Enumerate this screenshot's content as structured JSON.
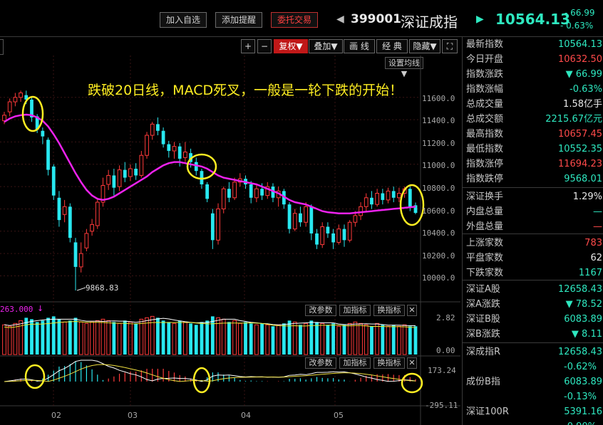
{
  "topbar": {
    "buttons": [
      "加入自选",
      "添加提醒",
      "委托交易"
    ],
    "prev_arrow": "◀",
    "next_arrow": "▶",
    "code": "399001",
    "name": "深证成指",
    "price": "10564.13",
    "change": "- 66.99",
    "change_pct": "- 0.63%"
  },
  "toolbar": {
    "plus": "+",
    "minus": "−",
    "restore": "复权",
    "overlay": "叠加",
    "draw_line": "画 线",
    "classic": "经 典",
    "hide": "隐藏",
    "avg_settings": "设置均线"
  },
  "annotation": "跌破20日线，MACD死叉，一般是一轮下跌的开始！",
  "price_axis": [
    "11600.0",
    "11400.0",
    "11200.0",
    "11000.0",
    "10800.0",
    "10600.0",
    "10400.0",
    "10200.0",
    "10000.0"
  ],
  "low_label": "9868.83",
  "volume_panel": {
    "label": "263.000",
    "param_btn": "改参数",
    "add_btn": "加指标",
    "switch_btn": "换指标",
    "axis": [
      "2.82",
      "0.00"
    ]
  },
  "macd_panel": {
    "param_btn": "改参数",
    "add_btn": "加指标",
    "switch_btn": "换指标",
    "axis": [
      "173.24",
      "-295.11"
    ]
  },
  "dates": [
    "02",
    "03",
    "04",
    "05"
  ],
  "colors": {
    "up": "#ff3a3a",
    "down": "#28e8f0",
    "ma20": "#ee22ee",
    "highlight": "#ffee22"
  },
  "info": [
    {
      "label": "最新指数",
      "value": "10564.13",
      "color": "#2ee8c0"
    },
    {
      "label": "今日开盘",
      "value": "10632.50",
      "color": "#ff4a4a"
    },
    {
      "label": "指数涨跌",
      "value": "▼ 66.99",
      "color": "#2ee8c0"
    },
    {
      "label": "指数涨幅",
      "value": "-0.63%",
      "color": "#2ee8c0"
    },
    {
      "label": "总成交量",
      "value": "1.58亿手",
      "color": "#e8e8e8"
    },
    {
      "label": "总成交额",
      "value": "2215.67亿元",
      "color": "#2ee8c0"
    },
    {
      "label": "最高指数",
      "value": "10657.45",
      "color": "#ff4a4a"
    },
    {
      "label": "最低指数",
      "value": "10552.35",
      "color": "#2ee8c0"
    },
    {
      "label": "指数涨停",
      "value": "11694.23",
      "color": "#ff4a4a"
    },
    {
      "label": "指数跌停",
      "value": "9568.01",
      "color": "#2ee8c0"
    },
    {
      "label": "深证换手",
      "value": "1.29%",
      "color": "#e8e8e8"
    },
    {
      "label": "内盘总量",
      "value": "—",
      "color": "#2ee8c0"
    },
    {
      "label": "外盘总量",
      "value": "—",
      "color": "#ff4a4a"
    },
    {
      "label": "上涨家数",
      "value": "783",
      "color": "#ff4a4a"
    },
    {
      "label": "平盘家数",
      "value": "62",
      "color": "#e8e8e8"
    },
    {
      "label": "下跌家数",
      "value": "1167",
      "color": "#2ee8c0"
    },
    {
      "label": "深证A股",
      "value": "12658.43",
      "color": "#2ee8c0"
    },
    {
      "label": "深A涨跌",
      "value": "▼ 78.52",
      "color": "#2ee8c0"
    },
    {
      "label": "深证B股",
      "value": "6083.89",
      "color": "#2ee8c0"
    },
    {
      "label": "深B涨跌",
      "value": "▼ 8.11",
      "color": "#2ee8c0"
    },
    {
      "label": "深成指R",
      "value": "12658.43",
      "color": "#2ee8c0"
    },
    {
      "label": "",
      "value": "-0.62%",
      "color": "#2ee8c0"
    },
    {
      "label": "成份B指",
      "value": "6083.89",
      "color": "#2ee8c0"
    },
    {
      "label": "",
      "value": "-0.13%",
      "color": "#2ee8c0"
    },
    {
      "label": "深证100R",
      "value": "5391.16",
      "color": "#2ee8c0"
    },
    {
      "label": "",
      "value": "-0.90%",
      "color": "#2ee8c0"
    }
  ],
  "chart_data": {
    "type": "candlestick",
    "series": [
      {
        "o": 11390,
        "c": 11440,
        "h": 11470,
        "l": 11360
      },
      {
        "o": 11470,
        "c": 11560,
        "h": 11590,
        "l": 11430
      },
      {
        "o": 11560,
        "c": 11600,
        "h": 11640,
        "l": 11520
      },
      {
        "o": 11600,
        "c": 11640,
        "h": 11660,
        "l": 11560
      },
      {
        "o": 11620,
        "c": 11580,
        "h": 11660,
        "l": 11540
      },
      {
        "o": 11580,
        "c": 11420,
        "h": 11600,
        "l": 11380
      },
      {
        "o": 11430,
        "c": 11310,
        "h": 11450,
        "l": 11280
      },
      {
        "o": 11300,
        "c": 11250,
        "h": 11330,
        "l": 11180
      },
      {
        "o": 11220,
        "c": 10950,
        "h": 11240,
        "l": 10900
      },
      {
        "o": 10980,
        "c": 10720,
        "h": 11000,
        "l": 10680
      },
      {
        "o": 10700,
        "c": 10500,
        "h": 10760,
        "l": 10440
      },
      {
        "o": 10550,
        "c": 10620,
        "h": 10680,
        "l": 10480
      },
      {
        "o": 10620,
        "c": 10340,
        "h": 10650,
        "l": 10300
      },
      {
        "o": 10300,
        "c": 10080,
        "h": 10340,
        "l": 9868.83
      },
      {
        "o": 10080,
        "c": 10200,
        "h": 10300,
        "l": 10030
      },
      {
        "o": 10250,
        "c": 10380,
        "h": 10420,
        "l": 10220
      },
      {
        "o": 10400,
        "c": 10460,
        "h": 10510,
        "l": 10360
      },
      {
        "o": 10450,
        "c": 10660,
        "h": 10700,
        "l": 10420
      },
      {
        "o": 10660,
        "c": 10810,
        "h": 10880,
        "l": 10620
      },
      {
        "o": 10820,
        "c": 10900,
        "h": 10950,
        "l": 10770
      },
      {
        "o": 10900,
        "c": 10790,
        "h": 10960,
        "l": 10720
      },
      {
        "o": 10800,
        "c": 10950,
        "h": 10990,
        "l": 10760
      },
      {
        "o": 10950,
        "c": 10880,
        "h": 11020,
        "l": 10840
      },
      {
        "o": 10890,
        "c": 10960,
        "h": 11000,
        "l": 10850
      },
      {
        "o": 10960,
        "c": 10900,
        "h": 11010,
        "l": 10860
      },
      {
        "o": 10900,
        "c": 11080,
        "h": 11120,
        "l": 10880
      },
      {
        "o": 11080,
        "c": 11260,
        "h": 11290,
        "l": 11050
      },
      {
        "o": 11260,
        "c": 11360,
        "h": 11380,
        "l": 11220
      },
      {
        "o": 11360,
        "c": 11300,
        "h": 11420,
        "l": 11260
      },
      {
        "o": 11300,
        "c": 11180,
        "h": 11330,
        "l": 11150
      },
      {
        "o": 11180,
        "c": 11120,
        "h": 11210,
        "l": 11060
      },
      {
        "o": 11120,
        "c": 11160,
        "h": 11200,
        "l": 11050
      },
      {
        "o": 11160,
        "c": 11050,
        "h": 11190,
        "l": 10980
      },
      {
        "o": 11060,
        "c": 11110,
        "h": 11200,
        "l": 11020
      },
      {
        "o": 11100,
        "c": 11020,
        "h": 11140,
        "l": 10970
      },
      {
        "o": 11020,
        "c": 10940,
        "h": 11060,
        "l": 10900
      },
      {
        "o": 10940,
        "c": 10820,
        "h": 10960,
        "l": 10780
      },
      {
        "o": 10820,
        "c": 10690,
        "h": 10840,
        "l": 10660
      },
      {
        "o": 10560,
        "c": 10320,
        "h": 10600,
        "l": 10240
      },
      {
        "o": 10320,
        "c": 10600,
        "h": 10650,
        "l": 10280
      },
      {
        "o": 10600,
        "c": 10780,
        "h": 10800,
        "l": 10560
      },
      {
        "o": 10780,
        "c": 10700,
        "h": 10840,
        "l": 10660
      },
      {
        "o": 10700,
        "c": 10840,
        "h": 10880,
        "l": 10680
      },
      {
        "o": 10840,
        "c": 10870,
        "h": 10920,
        "l": 10800
      },
      {
        "o": 10870,
        "c": 10820,
        "h": 10900,
        "l": 10780
      },
      {
        "o": 10820,
        "c": 10700,
        "h": 10850,
        "l": 10650
      },
      {
        "o": 10700,
        "c": 10780,
        "h": 10820,
        "l": 10660
      },
      {
        "o": 10780,
        "c": 10720,
        "h": 10830,
        "l": 10680
      },
      {
        "o": 10720,
        "c": 10800,
        "h": 10840,
        "l": 10690
      },
      {
        "o": 10800,
        "c": 10700,
        "h": 10830,
        "l": 10660
      },
      {
        "o": 10700,
        "c": 10760,
        "h": 10800,
        "l": 10620
      },
      {
        "o": 10760,
        "c": 10640,
        "h": 10780,
        "l": 10600
      },
      {
        "o": 10640,
        "c": 10420,
        "h": 10660,
        "l": 10380
      },
      {
        "o": 10420,
        "c": 10560,
        "h": 10600,
        "l": 10400
      },
      {
        "o": 10560,
        "c": 10480,
        "h": 10620,
        "l": 10440
      },
      {
        "o": 10480,
        "c": 10620,
        "h": 10660,
        "l": 10440
      },
      {
        "o": 10620,
        "c": 10380,
        "h": 10640,
        "l": 10320
      },
      {
        "o": 10380,
        "c": 10280,
        "h": 10420,
        "l": 10240
      },
      {
        "o": 10280,
        "c": 10440,
        "h": 10480,
        "l": 10250
      },
      {
        "o": 10440,
        "c": 10380,
        "h": 10480,
        "l": 10340
      },
      {
        "o": 10380,
        "c": 10300,
        "h": 10420,
        "l": 10240
      },
      {
        "o": 10300,
        "c": 10420,
        "h": 10460,
        "l": 10280
      },
      {
        "o": 10420,
        "c": 10320,
        "h": 10460,
        "l": 10260
      },
      {
        "o": 10320,
        "c": 10480,
        "h": 10500,
        "l": 10300
      },
      {
        "o": 10480,
        "c": 10540,
        "h": 10580,
        "l": 10440
      },
      {
        "o": 10540,
        "c": 10620,
        "h": 10660,
        "l": 10500
      },
      {
        "o": 10620,
        "c": 10700,
        "h": 10740,
        "l": 10580
      },
      {
        "o": 10700,
        "c": 10640,
        "h": 10760,
        "l": 10600
      },
      {
        "o": 10640,
        "c": 10740,
        "h": 10780,
        "l": 10620
      },
      {
        "o": 10740,
        "c": 10680,
        "h": 10780,
        "l": 10640
      },
      {
        "o": 10680,
        "c": 10760,
        "h": 10790,
        "l": 10650
      },
      {
        "o": 10760,
        "c": 10700,
        "h": 10800,
        "l": 10660
      },
      {
        "o": 10700,
        "c": 10740,
        "h": 10790,
        "l": 10660
      },
      {
        "o": 10740,
        "c": 10780,
        "h": 10800,
        "l": 10700
      },
      {
        "o": 10780,
        "c": 10620,
        "h": 10800,
        "l": 10580
      },
      {
        "o": 10632.5,
        "c": 10564.13,
        "h": 10657.45,
        "l": 10552.35
      }
    ],
    "ma20": [
      11380,
      11410,
      11430,
      11440,
      11445,
      11440,
      11420,
      11390,
      11340,
      11270,
      11190,
      11100,
      11010,
      10920,
      10840,
      10770,
      10720,
      10690,
      10680,
      10690,
      10710,
      10740,
      10770,
      10800,
      10830,
      10860,
      10890,
      10930,
      10960,
      10990,
      11010,
      11020,
      11020,
      11010,
      11000,
      10990,
      10980,
      10960,
      10930,
      10900,
      10880,
      10870,
      10860,
      10850,
      10840,
      10830,
      10820,
      10800,
      10780,
      10760,
      10740,
      10710,
      10680,
      10660,
      10650,
      10640,
      10620,
      10600,
      10580,
      10570,
      10565,
      10560,
      10560,
      10560,
      10565,
      10570,
      10575,
      10580,
      10585,
      10590,
      10595,
      10600,
      10605,
      10610,
      10615,
      10620
    ],
    "volume": [
      2.1,
      2.0,
      2.2,
      2.4,
      2.6,
      2.5,
      2.3,
      2.4,
      2.6,
      2.7,
      2.5,
      2.3,
      2.4,
      2.6,
      2.3,
      2.2,
      2.3,
      2.4,
      2.5,
      2.4,
      2.3,
      2.2,
      2.4,
      2.3,
      2.2,
      2.5,
      2.6,
      2.7,
      2.6,
      2.4,
      2.3,
      2.2,
      2.4,
      2.3,
      2.2,
      2.1,
      2.3,
      2.4,
      2.7,
      2.6,
      2.5,
      2.3,
      2.4,
      2.2,
      2.3,
      2.2,
      2.1,
      2.2,
      2.1,
      2.0,
      2.1,
      2.2,
      2.4,
      2.3,
      2.1,
      2.2,
      2.4,
      2.3,
      2.2,
      2.1,
      2.2,
      2.0,
      2.1,
      2.2,
      2.3,
      2.2,
      2.1,
      2.0,
      2.2,
      2.1,
      2.0,
      2.1,
      2.0,
      2.1,
      2.0,
      2.0
    ],
    "vol_ylim": [
      0,
      2.82
    ],
    "macd_ylim": [
      -295.11,
      173.24
    ],
    "ylim": [
      9868.83,
      11694.23
    ]
  }
}
